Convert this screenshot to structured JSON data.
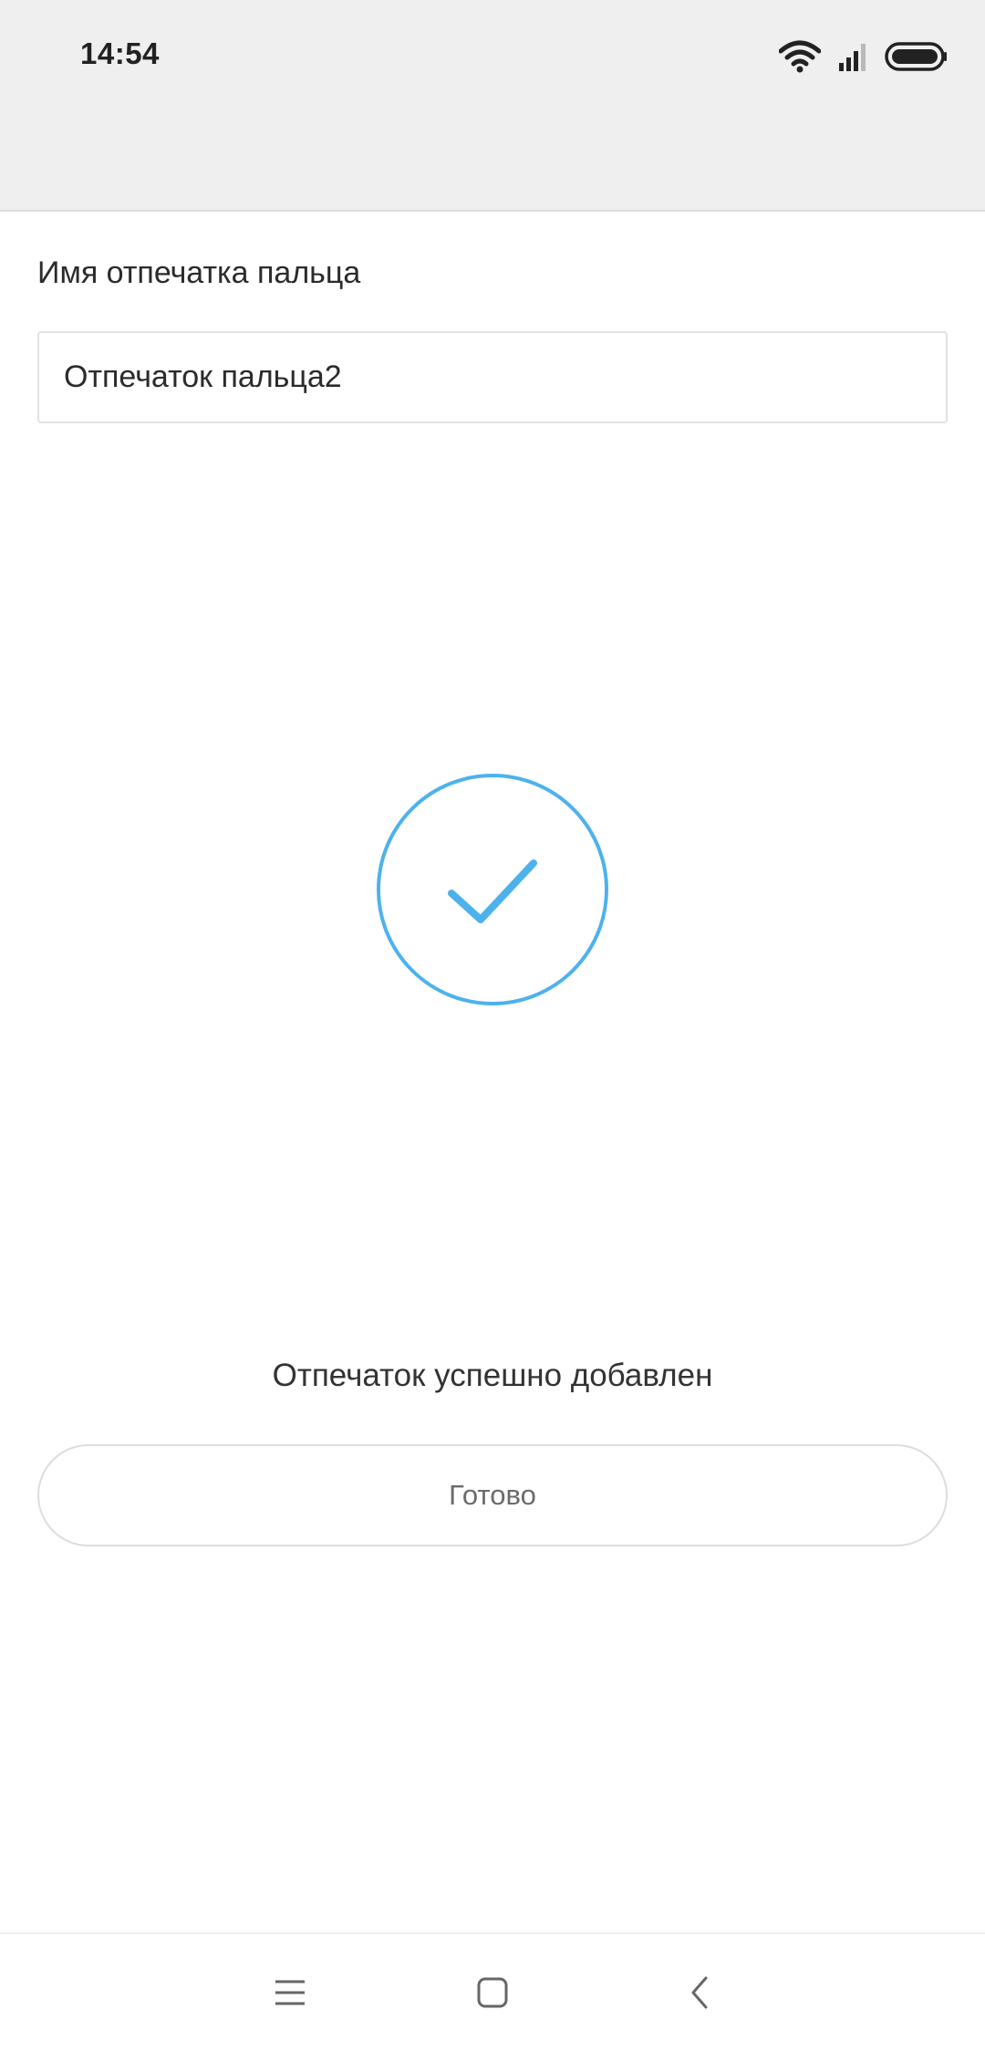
{
  "status_bar": {
    "time": "14:54",
    "icons": [
      "wifi-icon",
      "signal-icon",
      "battery-icon"
    ]
  },
  "form": {
    "label": "Имя отпечатка пальца",
    "name_value": "Отпечаток пальца2"
  },
  "success": {
    "icon": "check-circle-icon",
    "message": "Отпечаток успешно добавлен"
  },
  "actions": {
    "done_label": "Готово"
  },
  "nav_bar": {
    "icons": [
      "menu-icon",
      "home-icon",
      "back-icon"
    ]
  },
  "colors": {
    "accent": "#4db2ec",
    "status_bar_bg": "#efefef"
  }
}
